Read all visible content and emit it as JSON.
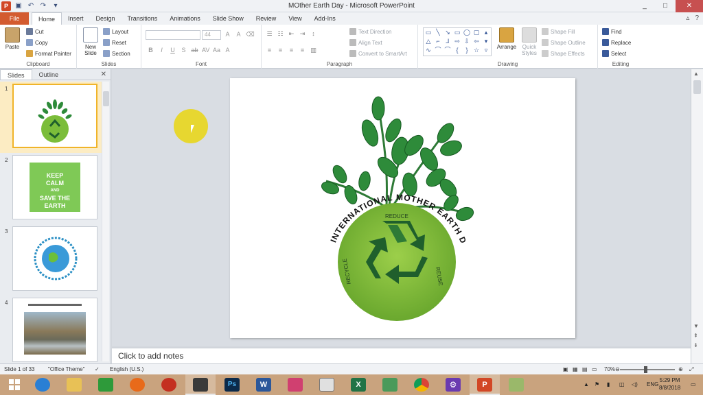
{
  "window": {
    "title": "MOther Earth Day - Microsoft PowerPoint",
    "app_icon": "P",
    "minimize": "_",
    "maximize": "□",
    "close": "✕"
  },
  "ribbon_tabs": {
    "file": "File",
    "tabs": [
      "Home",
      "Insert",
      "Design",
      "Transitions",
      "Animations",
      "Slide Show",
      "Review",
      "View",
      "Add-Ins"
    ],
    "active": "Home"
  },
  "clipboard": {
    "paste": "Paste",
    "cut": "Cut",
    "copy": "Copy",
    "format_painter": "Format Painter",
    "label": "Clipboard"
  },
  "slides_group": {
    "new_slide": "New Slide",
    "layout": "Layout",
    "reset": "Reset",
    "section": "Section",
    "label": "Slides"
  },
  "font_group": {
    "font_size": "44",
    "label": "Font"
  },
  "paragraph_group": {
    "text_direction": "Text Direction",
    "align_text": "Align Text",
    "convert_smartart": "Convert to SmartArt",
    "label": "Paragraph"
  },
  "drawing_group": {
    "arrange": "Arrange",
    "quick_styles": "Quick Styles",
    "shape_fill": "Shape Fill",
    "shape_outline": "Shape Outline",
    "shape_effects": "Shape Effects",
    "label": "Drawing"
  },
  "editing_group": {
    "find": "Find",
    "replace": "Replace",
    "select": "Select",
    "label": "Editing"
  },
  "panel": {
    "tabs": [
      "Slides",
      "Outline"
    ],
    "active": "Slides",
    "slide_numbers": [
      "1",
      "2",
      "3",
      "4"
    ],
    "keep_calm": [
      "KEEP",
      "CALM",
      "AND",
      "SAVE THE",
      "EARTH"
    ]
  },
  "slide": {
    "arc_text": "INTERNATIONAL MOTHER EARTH DAY",
    "reduce": "REDUCE",
    "reuse": "REUSE",
    "recycle": "RECYCLE"
  },
  "notes": {
    "placeholder": "Click to add notes"
  },
  "status": {
    "slide_counter": "Slide 1 of 33",
    "theme": "\"Office Theme\"",
    "language": "English (U.S.)",
    "zoom": "70%"
  },
  "tray": {
    "language": "ENG",
    "time": "5:29 PM",
    "date": "8/8/2018"
  },
  "colors": {
    "accent": "#d24726",
    "leaf": "#2e8b3a",
    "globe": "#7bbd3a",
    "recycle": "#1f5f2c",
    "taskbar": "#c9a37e"
  }
}
